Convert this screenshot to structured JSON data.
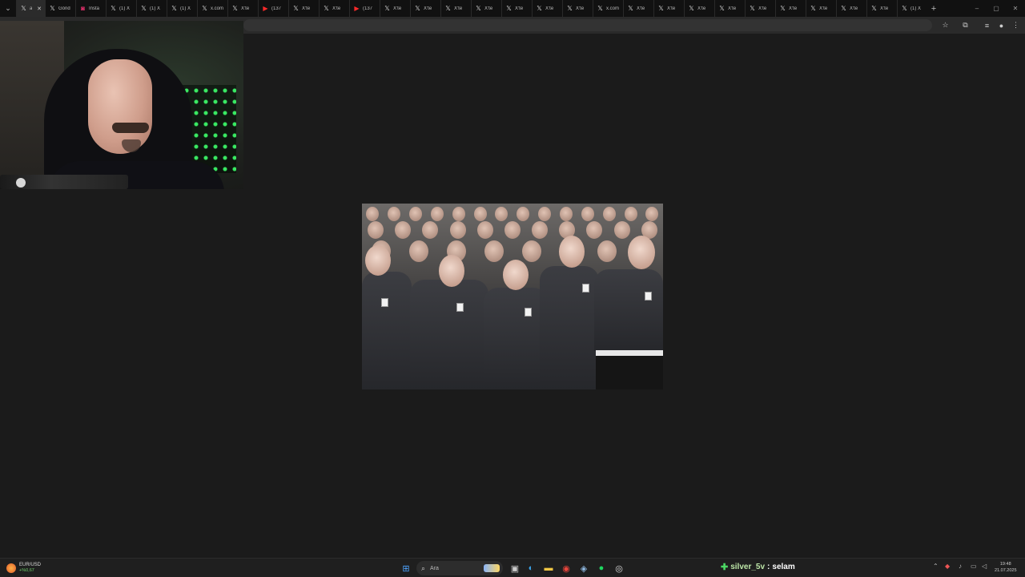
{
  "browser": {
    "tabs": [
      {
        "label": "a",
        "icon": "x-icon",
        "active": true
      },
      {
        "label": "Gönd",
        "icon": "x-icon"
      },
      {
        "label": "Insta",
        "icon": "instagram-icon"
      },
      {
        "label": "(1) X",
        "icon": "x-icon"
      },
      {
        "label": "(1) X",
        "icon": "x-icon"
      },
      {
        "label": "(1) X",
        "icon": "x-icon"
      },
      {
        "label": "x.com",
        "icon": "x-icon"
      },
      {
        "label": "X'te",
        "icon": "x-icon"
      },
      {
        "label": "(137",
        "icon": "youtube-icon"
      },
      {
        "label": "X'te",
        "icon": "x-icon"
      },
      {
        "label": "X'te",
        "icon": "x-icon"
      },
      {
        "label": "(137",
        "icon": "youtube-icon"
      },
      {
        "label": "X'te",
        "icon": "x-icon"
      },
      {
        "label": "X'te",
        "icon": "x-icon"
      },
      {
        "label": "X'te",
        "icon": "x-icon"
      },
      {
        "label": "X'te",
        "icon": "x-icon"
      },
      {
        "label": "X'te",
        "icon": "x-icon"
      },
      {
        "label": "X'te",
        "icon": "x-icon"
      },
      {
        "label": "X'te",
        "icon": "x-icon"
      },
      {
        "label": "x.com",
        "icon": "x-icon"
      },
      {
        "label": "X'te",
        "icon": "x-icon"
      },
      {
        "label": "X'te",
        "icon": "x-icon"
      },
      {
        "label": "X'te",
        "icon": "x-icon"
      },
      {
        "label": "X'te",
        "icon": "x-icon"
      },
      {
        "label": "X'te",
        "icon": "x-icon"
      },
      {
        "label": "X'te",
        "icon": "x-icon"
      },
      {
        "label": "X'te",
        "icon": "x-icon"
      },
      {
        "label": "X'te",
        "icon": "x-icon"
      },
      {
        "label": "X'te",
        "icon": "x-icon"
      },
      {
        "label": "(1) X",
        "icon": "x-icon"
      }
    ],
    "new_tab_glyph": "+",
    "tab_menu_glyph": "⌄",
    "close_glyph": "✕",
    "window_controls": {
      "minimize": "–",
      "restore": "▢",
      "close": "✕"
    },
    "toolbar_icons": {
      "bookmark": "☆",
      "extensions": "⧉",
      "media": "≡",
      "profile": "●",
      "menu": "⋮"
    }
  },
  "taskbar": {
    "widget": {
      "title": "EUR/USD",
      "change": "+%0,67"
    },
    "search_placeholder": "Ara",
    "apps": [
      "start-icon",
      "task-view-icon",
      "edge-icon",
      "file-explorer-icon",
      "chrome-icon",
      "steam-icon",
      "spotify-icon",
      "obs-icon"
    ],
    "chat": {
      "username": "silver_5v",
      "separator": ":",
      "message": "selam"
    },
    "clock": {
      "time": "19:48",
      "date": "21.07.2025"
    }
  },
  "colors": {
    "chrome_dark": "#111111",
    "page_bg": "#1b1b1b",
    "taskbar_bg": "#1f1f1f",
    "chat_green": "#4cd964"
  }
}
